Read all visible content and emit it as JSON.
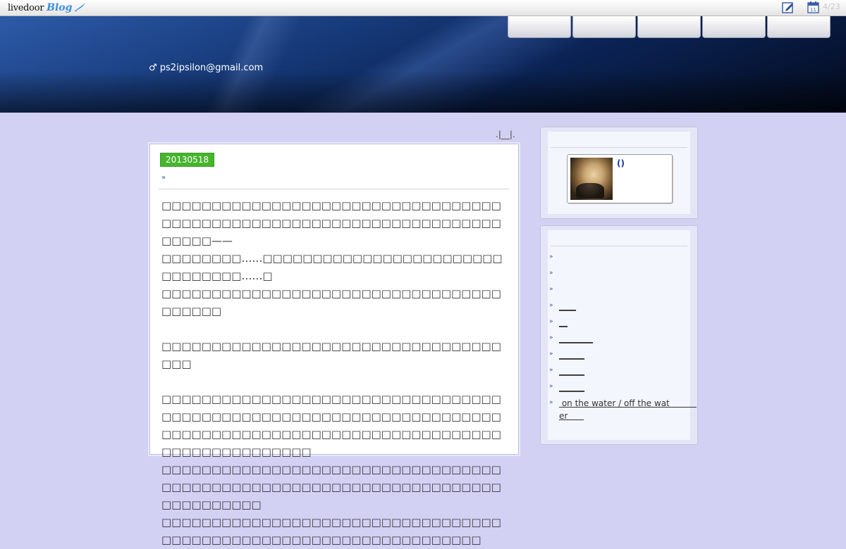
{
  "topbar": {
    "logo_text": "livedoor",
    "logo_sub": "Blog",
    "icons": [
      "edit-icon",
      "calendar-icon"
    ],
    "calendar_day": "11",
    "count": "4/23"
  },
  "header": {
    "nav": [
      "",
      "",
      "",
      "",
      ""
    ],
    "email": "♂ ps2ipsilon@gmail.com"
  },
  "breadcrumb": ".|__|.",
  "article": {
    "date": "20130518",
    "title_marker": "»",
    "paragraphs": [
      "□□□□□□□□□□□□□□□□□□□□□□□□□□□□□□□□□□□□□□□□□□□□□□□□□□□□□□□□□□□□□□□□□□□□□□□□□——",
      "□□□□□□□□……□□□□□□□□□□□□□□□□□□□□□□□□□□□□□□□□……□",
      "□□□□□□□□□□□□□□□□□□□□□□□□□□□□□□□□□□□□□□□□",
      "",
      "□□□□□□□□□□□□□□□□□□□□□□□□□□□□□□□□□□□□□",
      "",
      "□□□□□□□□□□□□□□□□□□□□□□□□□□□□□□□□□□□□□□□□□□□□□□□□□□□□□□□□□□□□□□□□□□□□□□□□□□□□□□□□□□□□□□□□□□□□□□□□□□□□□□□□□□□□□□□□□□□□□",
      "□□□□□□□□□□□□□□□□□□□□□□□□□□□□□□□□□□□□□□□□□□□□□□□□□□□□□□□□□□□□□□□□□□□□□□□□□□□□□□",
      "□□□□□□□□□□□□□□□□□□□□□□□□□□□□□□□□□□□□□□□□□□□□□□□□□□□□□□□□□□□□□□□□□□"
    ]
  },
  "sidebar": {
    "profile": {
      "name": "()"
    },
    "list": [
      {
        "marker": "»",
        "label": ""
      },
      {
        "marker": "»",
        "label": ""
      },
      {
        "marker": "»",
        "label": ""
      },
      {
        "marker": "»",
        "label": "____"
      },
      {
        "marker": "»",
        "label": "__"
      },
      {
        "marker": "»",
        "label": "________"
      },
      {
        "marker": "»",
        "label": "______"
      },
      {
        "marker": "»",
        "label": "______"
      },
      {
        "marker": "»",
        "label": "______"
      },
      {
        "marker": "»",
        "label": " on the water / off the wat          \ner      "
      }
    ]
  }
}
